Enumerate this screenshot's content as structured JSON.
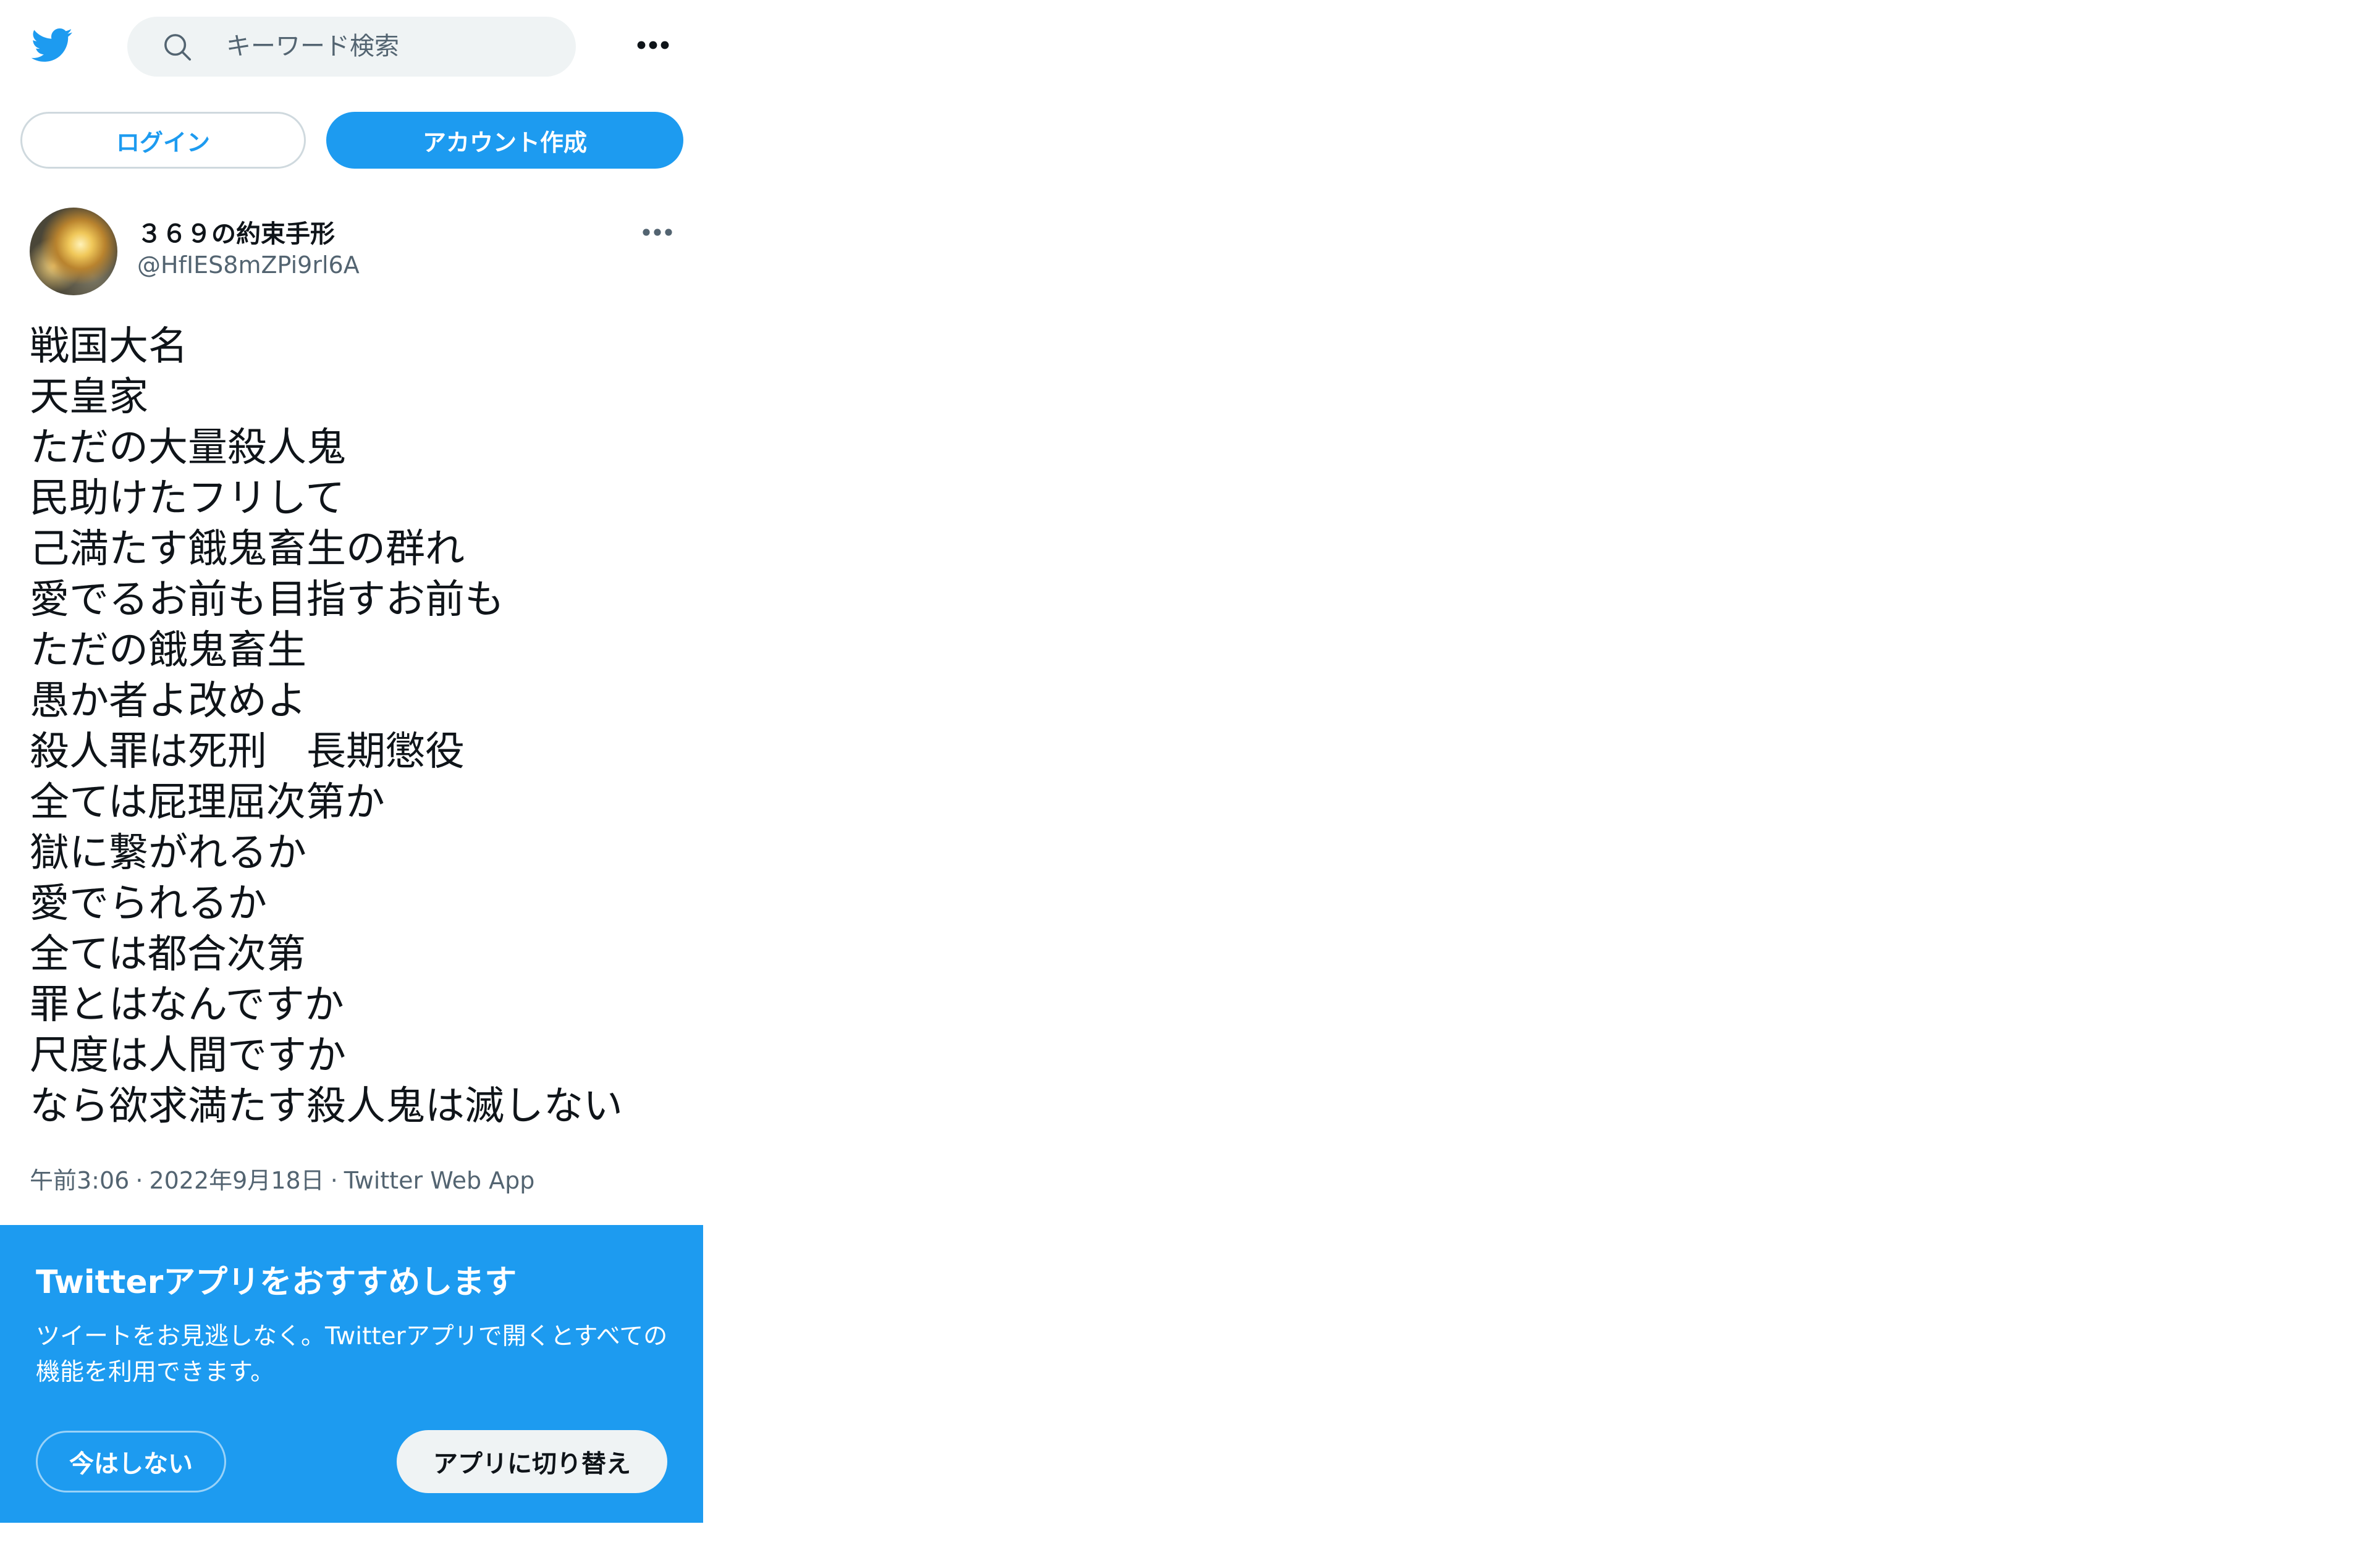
{
  "colors": {
    "brand": "#1d9bf0",
    "text_primary": "#0f1419",
    "text_secondary": "#536471",
    "search_bg": "#eff3f4",
    "border": "#cfd9de"
  },
  "header": {
    "logo_icon": "twitter-bird-icon",
    "search": {
      "icon": "search-icon",
      "placeholder": "キーワード検索",
      "value": ""
    },
    "more_icon": "more-horizontal-icon"
  },
  "auth": {
    "login_label": "ログイン",
    "signup_label": "アカウント作成"
  },
  "tweet": {
    "author": {
      "display_name": "３６９の約束手形",
      "handle": "@HfIES8mZPi9rl6A"
    },
    "more_icon": "more-horizontal-icon",
    "lines": [
      "戦国大名",
      "天皇家",
      "ただの大量殺人鬼",
      "民助けたフリして",
      "己満たす餓鬼畜生の群れ",
      "愛でるお前も目指すお前も",
      "ただの餓鬼畜生",
      "愚か者よ改めよ",
      "殺人罪は死刑　長期懲役",
      "全ては屁理屈次第か",
      "獄に繋がれるか",
      "愛でられるか",
      "全ては都合次第",
      "罪とはなんですか",
      "尺度は人間ですか",
      "なら欲求満たす殺人鬼は滅しない"
    ],
    "meta": {
      "time": "午前3:06",
      "separator": "·",
      "date": "2022年9月18日",
      "source": "Twitter Web App"
    }
  },
  "promo": {
    "title": "Twitterアプリをおすすめします",
    "text": "ツイートをお見逃しなく。Twitterアプリで開くとすべての機能を利用できます。",
    "not_now_label": "今はしない",
    "switch_label": "アプリに切り替え"
  }
}
